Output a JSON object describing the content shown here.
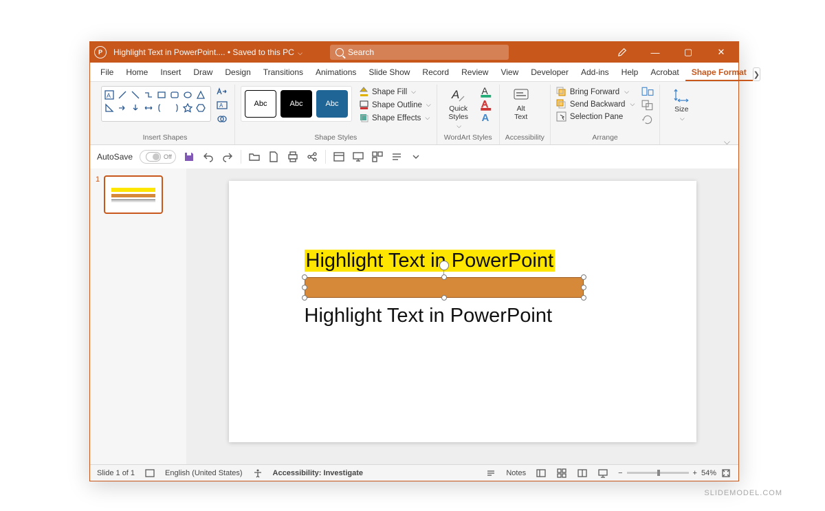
{
  "titlebar": {
    "doc_name": "Highlight Text in PowerPoint....",
    "saved_state": "• Saved to this PC",
    "search_placeholder": "Search"
  },
  "tabs": [
    "File",
    "Home",
    "Insert",
    "Draw",
    "Design",
    "Transitions",
    "Animations",
    "Slide Show",
    "Record",
    "Review",
    "View",
    "Developer",
    "Add-ins",
    "Help",
    "Acrobat",
    "Shape Format"
  ],
  "active_tab": "Shape Format",
  "ribbon": {
    "insert_shapes": "Insert Shapes",
    "shape_styles": "Shape Styles",
    "wordart_styles": "WordArt Styles",
    "accessibility": "Accessibility",
    "arrange": "Arrange",
    "size": "Size",
    "style_swatch_label": "Abc",
    "shape_fill": "Shape Fill",
    "shape_outline": "Shape Outline",
    "shape_effects": "Shape Effects",
    "quick_styles": "Quick\nStyles",
    "alt_text": "Alt\nText",
    "bring_forward": "Bring Forward",
    "send_backward": "Send Backward",
    "selection_pane": "Selection Pane"
  },
  "qat": {
    "autosave": "AutoSave",
    "autosave_state": "Off"
  },
  "thumbs": {
    "num": "1"
  },
  "slide": {
    "highlighted_text": "Highlight Text in PowerPoint",
    "plain_text": "Highlight Text in PowerPoint"
  },
  "status": {
    "slide_count": "Slide 1 of 1",
    "language": "English (United States)",
    "accessibility": "Accessibility: Investigate",
    "notes": "Notes",
    "zoom": "54%"
  },
  "watermark": "SLIDEMODEL.COM"
}
